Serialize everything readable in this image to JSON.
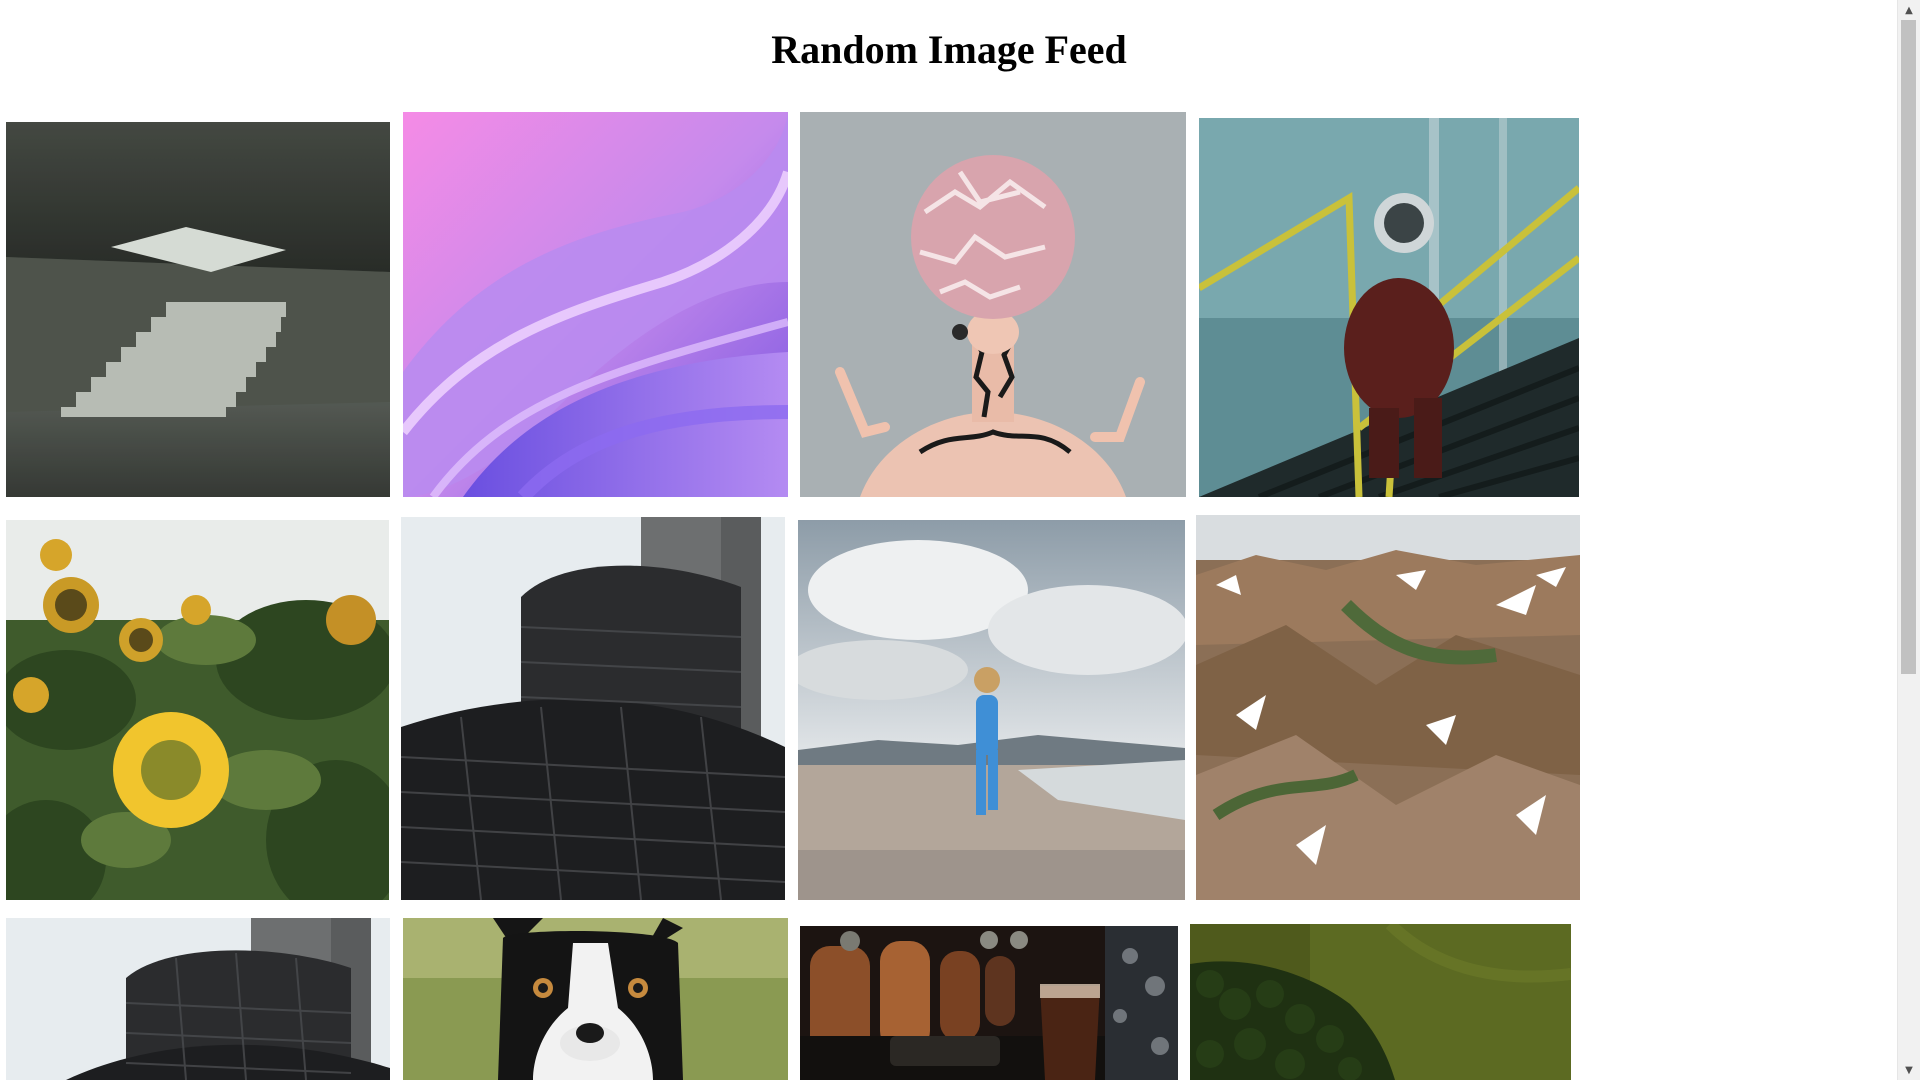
{
  "page": {
    "title": "Random Image Feed"
  },
  "feed": {
    "images": [
      {
        "subject": "concrete room with staircase and skylight"
      },
      {
        "subject": "abstract purple pink wave"
      },
      {
        "subject": "woman with patterned sphere head"
      },
      {
        "subject": "astronaut climbing stairs"
      },
      {
        "subject": "sunflowers"
      },
      {
        "subject": "dark tiled tower building"
      },
      {
        "subject": "woman walking on beach"
      },
      {
        "subject": "snowy colorful mountains"
      },
      {
        "subject": "dark tiled tower building"
      },
      {
        "subject": "boston terrier dog"
      },
      {
        "subject": "blurred cafe with drink"
      },
      {
        "subject": "green forest aerial"
      }
    ]
  },
  "scrollbar": {
    "up_icon": "triangle-up-icon",
    "down_icon": "triangle-down-icon"
  }
}
